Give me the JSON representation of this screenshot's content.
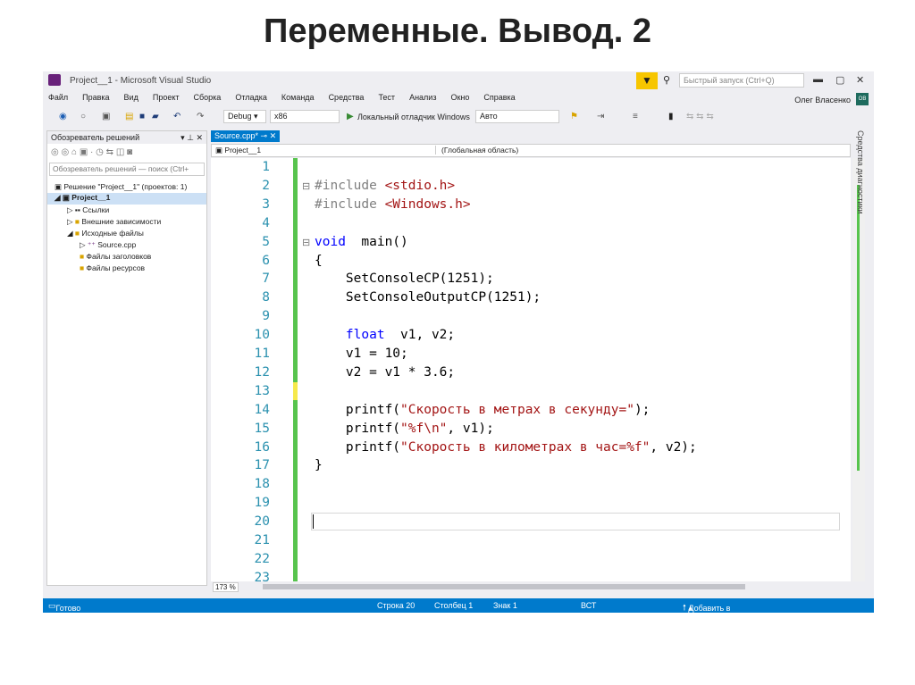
{
  "slide_title": "Переменные. Вывод. 2",
  "window": {
    "title": "Project__1 - Microsoft Visual Studio",
    "quick_launch_placeholder": "Быстрый запуск (Ctrl+Q)",
    "user": "Олег Власенко",
    "user_initials": "ОВ"
  },
  "menu": [
    "Файл",
    "Правка",
    "Вид",
    "Проект",
    "Сборка",
    "Отладка",
    "Команда",
    "Средства",
    "Тест",
    "Анализ",
    "Окно",
    "Справка"
  ],
  "toolbar": {
    "config": "Debug",
    "platform": "x86",
    "debugger": "Локальный отладчик Windows",
    "auto": "Авто"
  },
  "solution_explorer": {
    "title": "Обозреватель решений",
    "search_placeholder": "Обозреватель решений — поиск (Ctrl+",
    "items": [
      "Решение \"Project__1\" (проектов: 1)",
      "Project__1",
      "Ссылки",
      "Внешние зависимости",
      "Исходные файлы",
      "Source.cpp",
      "Файлы заголовков",
      "Файлы ресурсов"
    ]
  },
  "editor": {
    "tab": "Source.cpp*",
    "nav_project": "Project__1",
    "nav_scope": "(Глобальная область)",
    "zoom": "173 %",
    "lines": [
      [],
      [
        [
          "pp",
          "#include "
        ],
        [
          "str",
          "<stdio.h>"
        ]
      ],
      [
        [
          "pp",
          "#include "
        ],
        [
          "str",
          "<Windows.h>"
        ]
      ],
      [],
      [
        [
          "kw",
          "void"
        ],
        [
          "",
          "  main()"
        ]
      ],
      [
        [
          "",
          "{"
        ]
      ],
      [
        [
          "",
          "    SetConsoleCP(1251);"
        ]
      ],
      [
        [
          "",
          "    SetConsoleOutputCP(1251);"
        ]
      ],
      [],
      [
        [
          "kw",
          "    float"
        ],
        [
          "",
          "  v1, v2;"
        ]
      ],
      [
        [
          "",
          "    v1 = 10;"
        ]
      ],
      [
        [
          "",
          "    v2 = v1 * 3.6;"
        ]
      ],
      [],
      [
        [
          "",
          "    printf("
        ],
        [
          "str",
          "\"Скорость в метрах в секунду=\""
        ],
        [
          "",
          ");"
        ]
      ],
      [
        [
          "",
          "    printf("
        ],
        [
          "str",
          "\"%f\\n\""
        ],
        [
          "",
          ", v1);"
        ]
      ],
      [
        [
          "",
          "    printf("
        ],
        [
          "str",
          "\"Скорость в километрах в час=%f\""
        ],
        [
          "",
          ", v2);"
        ]
      ],
      [
        [
          "",
          "}"
        ]
      ],
      [],
      [],
      [],
      [],
      [],
      []
    ]
  },
  "side_panel": "Средства диагностики",
  "status": {
    "ready": "Готово",
    "row": "Строка 20",
    "col": "Столбец 1",
    "char": "Знак 1",
    "mode": "ВСТ",
    "vcs": "Добавить в систему управления версиями"
  },
  "colors": {
    "accent": "#007acc",
    "keyword": "#0000ff",
    "string": "#a31515",
    "line_number": "#2b91af",
    "change_bar": "#57c44d"
  }
}
